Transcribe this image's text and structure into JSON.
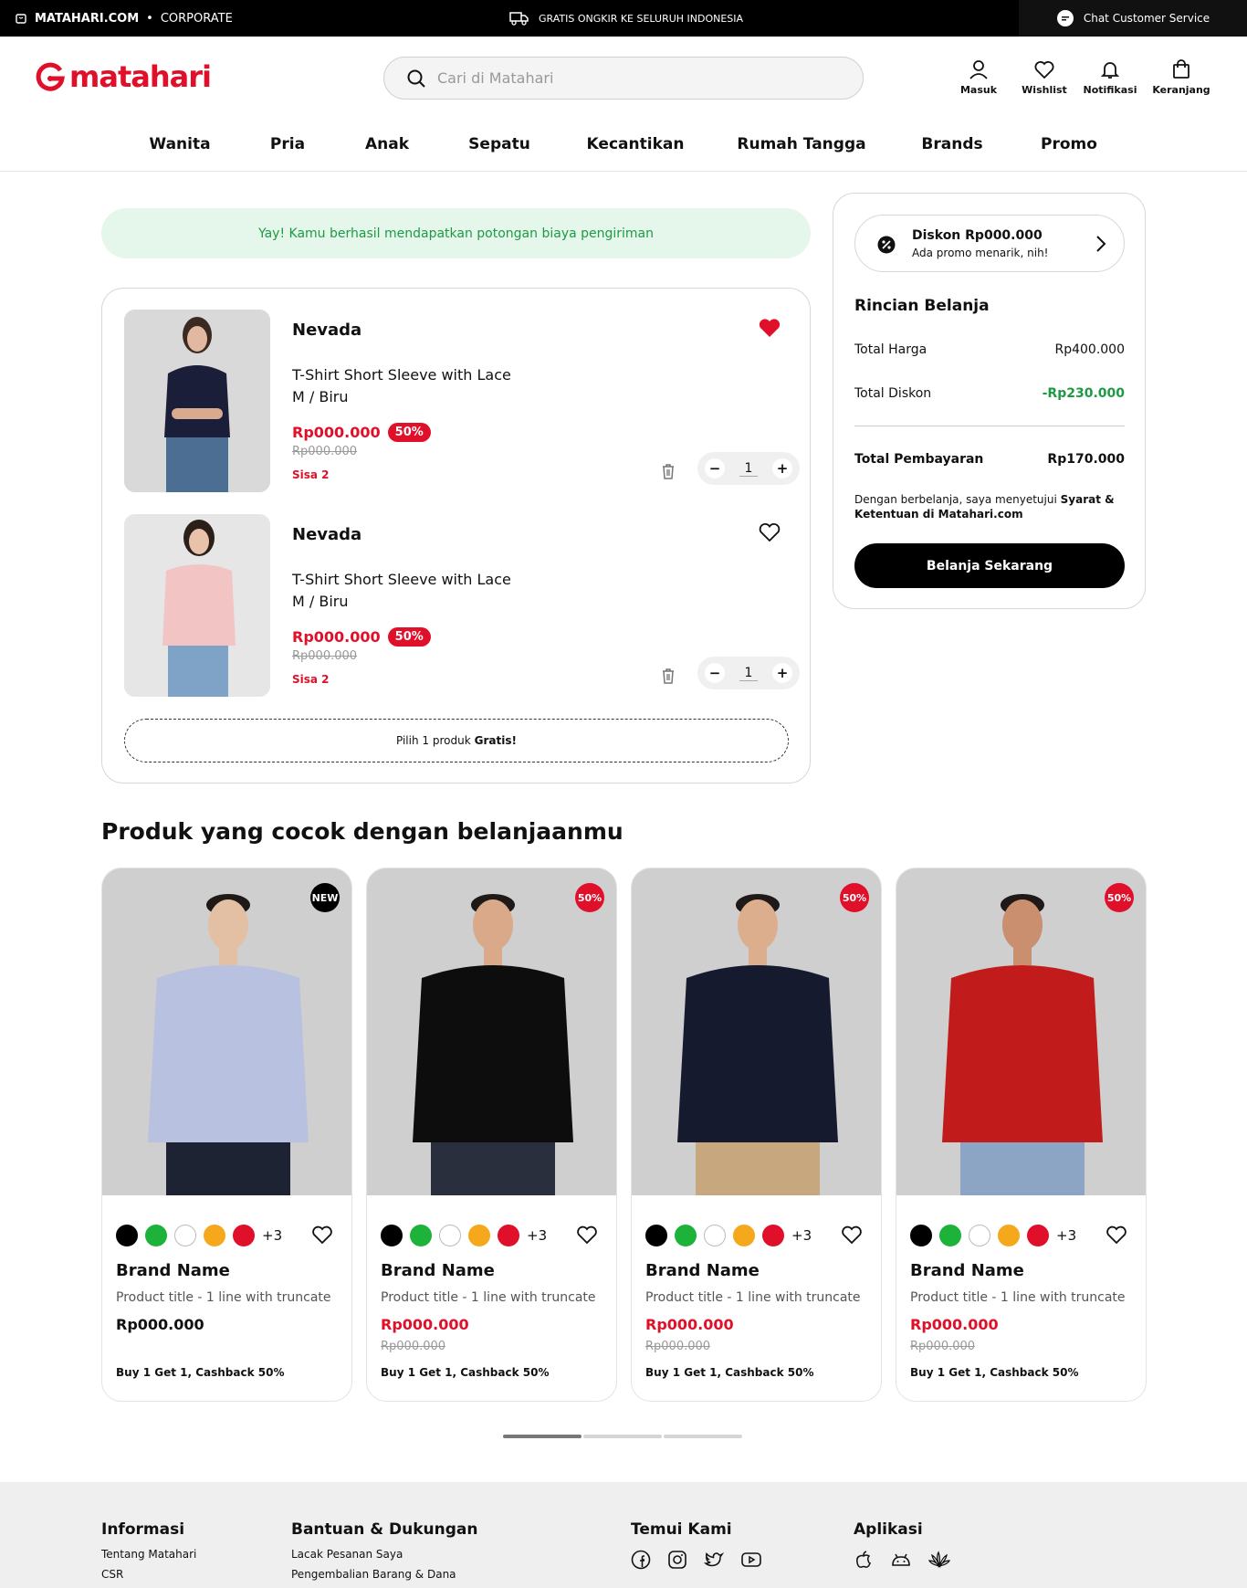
{
  "topbar": {
    "site": "MATAHARI.COM",
    "separator": "•",
    "corporate": "CORPORATE",
    "shipping": "GRATIS ONGKIR KE SELURUH INDONESIA",
    "chat": "Chat Customer Service"
  },
  "header": {
    "logo": "matahari",
    "search_placeholder": "Cari di Matahari",
    "icons": [
      {
        "label": "Masuk",
        "icon": "user-icon"
      },
      {
        "label": "Wishlist",
        "icon": "heart-icon"
      },
      {
        "label": "Notifikasi",
        "icon": "bell-icon"
      },
      {
        "label": "Keranjang",
        "icon": "bag-icon"
      }
    ]
  },
  "nav": [
    "Wanita",
    "Pria",
    "Anak",
    "Sepatu",
    "Kecantikan",
    "Rumah Tangga",
    "Brands",
    "Promo"
  ],
  "alert": "Yay! Kamu berhasil mendapatkan potongan biaya pengiriman",
  "cart": {
    "items": [
      {
        "brand": "Nevada",
        "title": "T-Shirt Short Sleeve with Lace",
        "variant": "M / Biru",
        "price": "Rp000.000",
        "discount": "50%",
        "old_price": "Rp000.000",
        "stock": "Sisa 2",
        "qty": "1",
        "wishlisted": true
      },
      {
        "brand": "Nevada",
        "title": "T-Shirt Short Sleeve with Lace",
        "variant": "M / Biru",
        "price": "Rp000.000",
        "discount": "50%",
        "old_price": "Rp000.000",
        "stock": "Sisa 2",
        "qty": "1",
        "wishlisted": false
      }
    ],
    "free_prefix": "Pilih 1 produk",
    "free_bold": "Gratis!"
  },
  "summary": {
    "promo_title": "Diskon Rp000.000",
    "promo_sub": "Ada promo menarik, nih!",
    "title": "Rincian Belanja",
    "total_price_label": "Total Harga",
    "total_price": "Rp400.000",
    "total_discount_label": "Total Diskon",
    "total_discount": "-Rp230.000",
    "payment_label": "Total Pembayaran",
    "payment": "Rp170.000",
    "terms_prefix": "Dengan berbelanja, saya menyetujui",
    "terms_bold": "Syarat & Ketentuan di Matahari.com",
    "checkout": "Belanja Sekarang"
  },
  "recommendations": {
    "title": "Produk yang cocok dengan belanjaanmu",
    "swatch_colors": [
      "#000000",
      "#1db33a",
      "#ffffff",
      "#f5a81c",
      "#e0102a"
    ],
    "products": [
      {
        "tag": "NEW",
        "tag_color": "#000000",
        "more": "+3",
        "brand": "Brand Name",
        "title": "Product title - 1 line with truncate",
        "price": "Rp000.000",
        "old_price": "",
        "promo": "Buy 1 Get 1, Cashback 50%",
        "shirt_color": "#b8c2e0"
      },
      {
        "tag": "50%",
        "tag_color": "#e0102a",
        "more": "+3",
        "brand": "Brand Name",
        "title": "Product title - 1 line with truncate",
        "price": "Rp000.000",
        "old_price": "Rp000.000",
        "promo": "Buy 1 Get 1, Cashback 50%",
        "shirt_color": "#0d0d0d"
      },
      {
        "tag": "50%",
        "tag_color": "#e0102a",
        "more": "+3",
        "brand": "Brand Name",
        "title": "Product title - 1 line with truncate",
        "price": "Rp000.000",
        "old_price": "Rp000.000",
        "promo": "Buy 1 Get 1, Cashback 50%",
        "shirt_color": "#151a2e"
      },
      {
        "tag": "50%",
        "tag_color": "#e0102a",
        "more": "+3",
        "brand": "Brand Name",
        "title": "Product title - 1 line with truncate",
        "price": "Rp000.000",
        "old_price": "Rp000.000",
        "promo": "Buy 1 Get 1, Cashback 50%",
        "shirt_color": "#c21b1b"
      }
    ]
  },
  "footer": {
    "info_title": "Informasi",
    "info_links": [
      "Tentang Matahari",
      "CSR"
    ],
    "help_title": "Bantuan & Dukungan",
    "help_links": [
      "Lacak Pesanan Saya",
      "Pengembalian Barang & Dana"
    ],
    "social_title": "Temui Kami",
    "app_title": "Aplikasi"
  },
  "colors": {
    "accent": "#e0102a",
    "success": "#1e9a45"
  }
}
